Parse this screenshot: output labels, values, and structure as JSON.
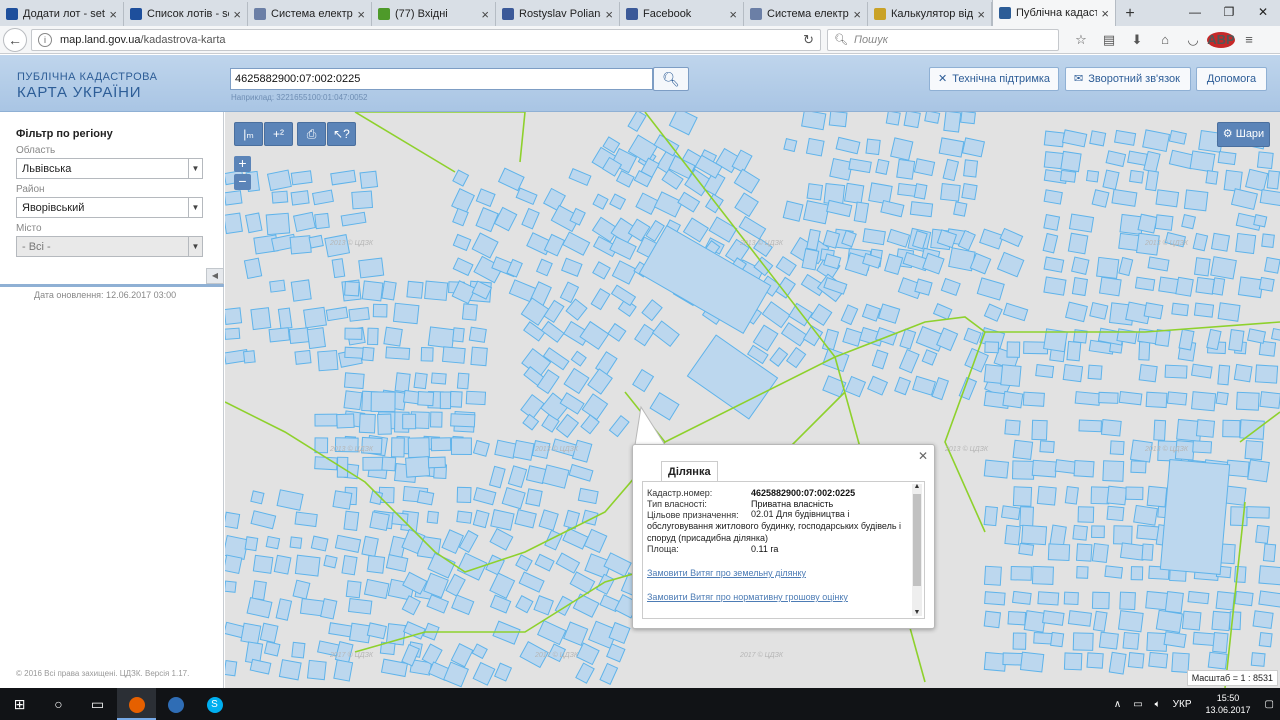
{
  "browser": {
    "tabs": [
      {
        "title": "Додати лот - setam.n",
        "color": "#1e4f9c"
      },
      {
        "title": "Список лотів - setam",
        "color": "#1e4f9c"
      },
      {
        "title": "Система електро",
        "color": "#6b7fa6"
      },
      {
        "title": "(77) Вхідні",
        "color": "#4e9a2a"
      },
      {
        "title": "Rostyslav Polians",
        "color": "#3b5998"
      },
      {
        "title": "Facebook",
        "color": "#3b5998"
      },
      {
        "title": "Система електро",
        "color": "#6b7fa6"
      },
      {
        "title": "Калькулятор від",
        "color": "#c9a227"
      },
      {
        "title": "Публічна кадаст",
        "color": "#2d5d97",
        "active": true
      }
    ],
    "url_host": "map.land.gov.ua",
    "url_path": "/kadastrova-karta",
    "search_placeholder": "Пошук"
  },
  "header": {
    "logo_line1": "ПУБЛІЧНА КАДАСТРОВА",
    "logo_line2": "КАРТА УКРАЇНИ",
    "search_value": "4625882900:07:002:0225",
    "example": "Наприклад: 3221655100:01:047:0052",
    "buttons": {
      "support": "Технічна підтримка",
      "feedback": "Зворотний зв'язок",
      "help": "Допомога"
    }
  },
  "filter": {
    "title": "Фільтр по регіону",
    "region_label": "Область",
    "region_value": "Львівська",
    "district_label": "Район",
    "district_value": "Яворівський",
    "city_label": "Місто",
    "city_value": "- Всі -",
    "update_date": "Дата оновлення: 12.06.2017 03:00",
    "copyright": "© 2016 Всі права захищені. ЦДЗК. Версія 1.17."
  },
  "map": {
    "layers_label": "Шари",
    "watermark": "2013 © ЦДЗК",
    "watermark2": "2017 © ЦДЗК",
    "scale": "Масштаб = 1 : 8531"
  },
  "popup": {
    "tab": "Ділянка",
    "cadastral_label": "Кадастр.номер:",
    "cadastral_value": "4625882900:07:002:0225",
    "ownership_label": "Тип власності:",
    "ownership_value": "Приватна власність",
    "purpose_label": "Цільове призначення:",
    "purpose_value": "02.01 Для будівництва і обслуговування житлового будинку, господарських будівель і споруд (присадибна ділянка)",
    "area_label": "Площа:",
    "area_value": "0.11 га",
    "link1": "Замовити Витяг про земельну ділянку",
    "link2": "Замовити Витяг про нормативну грошову оцінку"
  },
  "taskbar": {
    "lang": "УКР",
    "time": "15:50",
    "date": "13.06.2017"
  }
}
